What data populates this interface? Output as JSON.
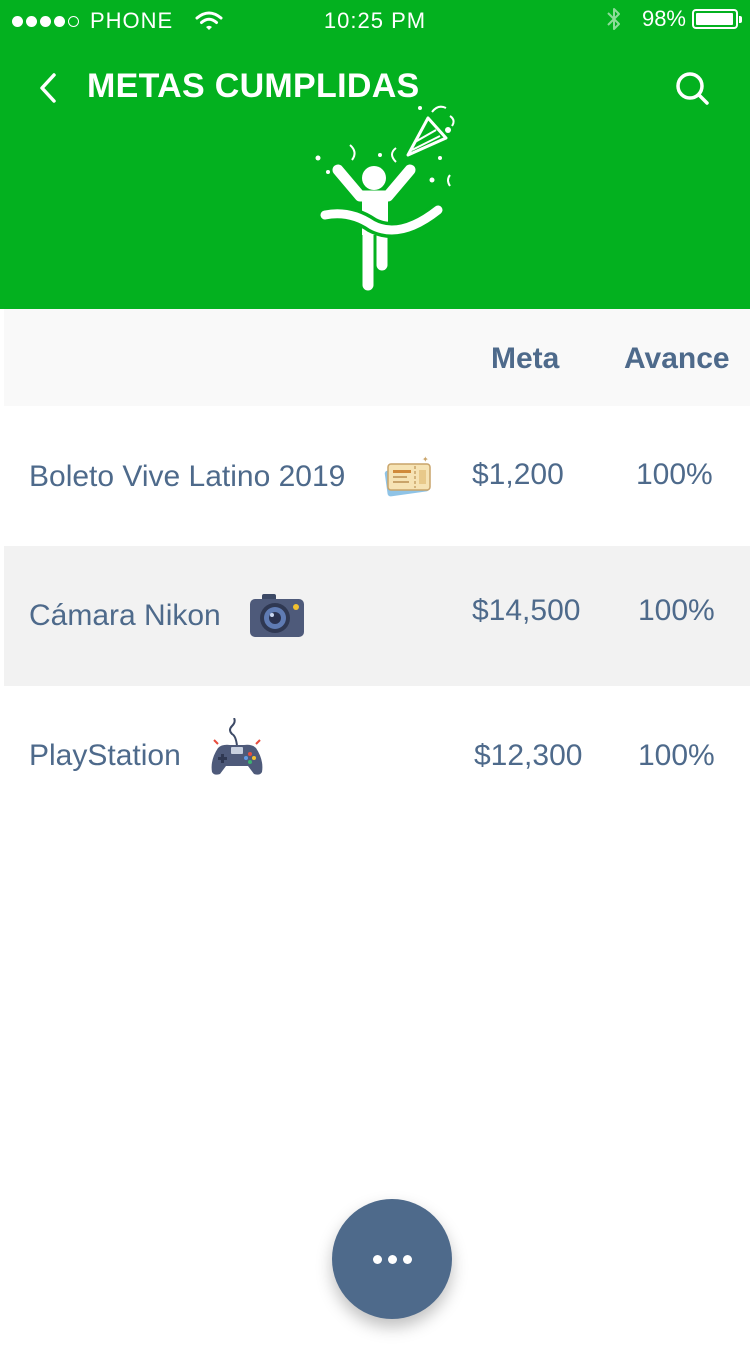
{
  "status_bar": {
    "carrier": "PHONE",
    "time": "10:25 PM",
    "battery": "98%",
    "battery_level": 0.98
  },
  "header": {
    "title": "METAS CUMPLIDAS",
    "back_icon": "chevron-left-icon",
    "search_icon": "search-icon",
    "hero_icon": "finish-line-celebration-icon",
    "background_color": "#03b11f"
  },
  "table": {
    "columns": [
      "Meta",
      "Avance"
    ],
    "rows": [
      {
        "name": "Boleto Vive Latino 2019",
        "icon": "ticket-icon",
        "meta": "$1,200",
        "avance": "100%"
      },
      {
        "name": "Cámara Nikon",
        "icon": "camera-icon",
        "meta": "$14,500",
        "avance": "100%"
      },
      {
        "name": "PlayStation",
        "icon": "gamepad-icon",
        "meta": "$12,300",
        "avance": "100%"
      }
    ],
    "text_color": "#4e6a8b"
  },
  "fab": {
    "icon": "more-horizontal-icon",
    "color": "#4e6a8b"
  }
}
